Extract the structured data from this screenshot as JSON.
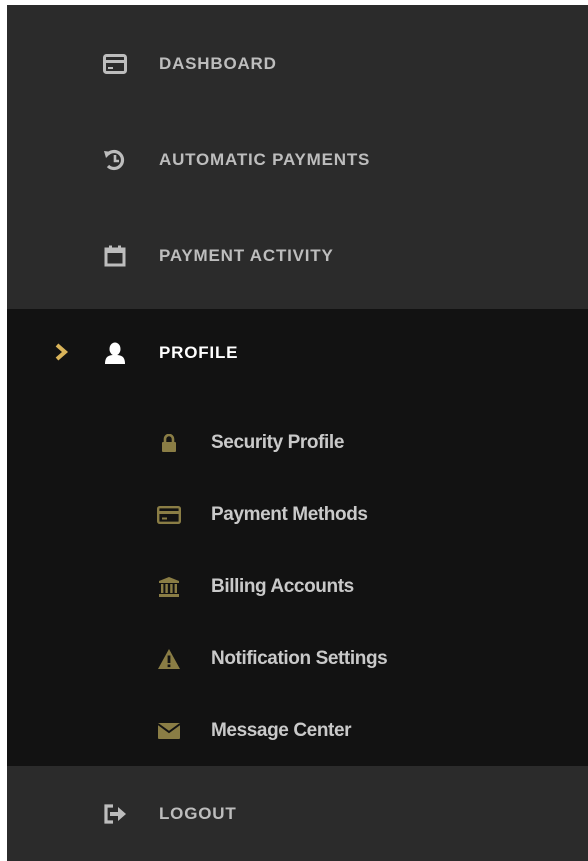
{
  "nav": {
    "items": [
      {
        "label": "DASHBOARD",
        "icon": "credit-card-icon"
      },
      {
        "label": "AUTOMATIC PAYMENTS",
        "icon": "history-icon"
      },
      {
        "label": "PAYMENT ACTIVITY",
        "icon": "calendar-icon"
      }
    ],
    "profile": {
      "label": "PROFILE",
      "icon": "user-icon",
      "expanded": true,
      "subitems": [
        {
          "label": "Security Profile",
          "icon": "lock-icon"
        },
        {
          "label": "Payment Methods",
          "icon": "credit-card-icon"
        },
        {
          "label": "Billing Accounts",
          "icon": "bank-icon"
        },
        {
          "label": "Notification Settings",
          "icon": "warning-icon"
        },
        {
          "label": "Message Center",
          "icon": "envelope-icon"
        }
      ]
    },
    "logout": {
      "label": "LOGOUT",
      "icon": "logout-icon"
    }
  },
  "colors": {
    "sidebar_bg": "#2b2b2b",
    "active_section_bg": "#121212",
    "accent_gold": "#d9b45a",
    "submenu_icon_olive": "#8a7d45",
    "label_gray": "#bdbdbd",
    "active_label": "#ffffff"
  }
}
